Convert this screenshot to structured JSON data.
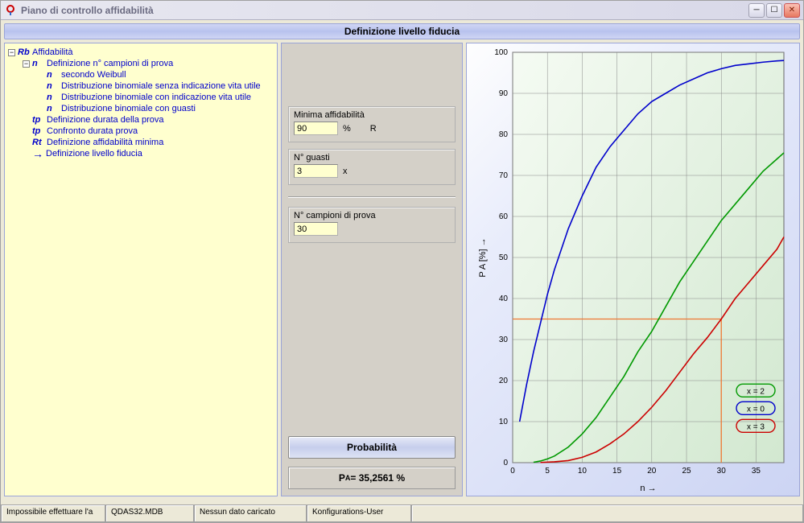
{
  "window": {
    "title": "Piano di controllo affidabilità"
  },
  "header": {
    "title": "Definizione livello fiducia"
  },
  "tree": {
    "root": {
      "icon": "Rb",
      "label": "Affidabilità",
      "children": [
        {
          "icon": "n",
          "label": "Definizione n° campioni di prova",
          "children": [
            {
              "icon": "n",
              "label": "secondo Weibull"
            },
            {
              "icon": "n",
              "label": "Distribuzione binomiale senza indicazione vita utile"
            },
            {
              "icon": "n",
              "label": "Distribuzione binomiale con indicazione vita utile"
            },
            {
              "icon": "n",
              "label": "Distribuzione binomiale con guasti"
            }
          ]
        },
        {
          "icon": "tp",
          "label": "Definizione durata della prova"
        },
        {
          "icon": "tp",
          "label": "Confronto durata prova"
        },
        {
          "icon": "Rt",
          "label": "Definizione affidabilità minima"
        },
        {
          "icon": "→",
          "label": "Definizione livello fiducia"
        }
      ]
    }
  },
  "form": {
    "min_reliability": {
      "label": "Minima affidabilità",
      "value": "90",
      "unit": "%",
      "suffix": "R"
    },
    "failures": {
      "label": "N° guasti",
      "value": "3",
      "unit": "x"
    },
    "samples": {
      "label": "N° campioni di prova",
      "value": "30"
    },
    "probability_button": "Probabilità",
    "result_prefix": "P",
    "result_sub": "A",
    "result_eq": "  = 35,2561 %"
  },
  "chart_data": {
    "type": "line",
    "xlabel": "n →",
    "ylabel": "P_A [%] →",
    "xlim": [
      0,
      39
    ],
    "ylim": [
      0,
      100
    ],
    "xticks": [
      0,
      5,
      10,
      15,
      20,
      25,
      30,
      35
    ],
    "yticks": [
      0,
      10,
      20,
      30,
      40,
      50,
      60,
      70,
      80,
      90,
      100
    ],
    "guide": {
      "x": 30,
      "y": 35
    },
    "legend": [
      {
        "name": "x = 2",
        "color": "#009900"
      },
      {
        "name": "x = 0",
        "color": "#0000cc"
      },
      {
        "name": "x = 3",
        "color": "#cc0000"
      }
    ],
    "series": [
      {
        "name": "x = 0",
        "color": "#0000cc",
        "x": [
          1,
          2,
          3,
          4,
          5,
          6,
          8,
          10,
          12,
          14,
          16,
          18,
          20,
          22,
          24,
          26,
          28,
          30,
          32,
          34,
          36,
          38,
          39
        ],
        "y": [
          10,
          19,
          27,
          34,
          41,
          47,
          57,
          65,
          72,
          77,
          81,
          85,
          88,
          90,
          92,
          93.5,
          95,
          96,
          96.8,
          97.2,
          97.6,
          97.9,
          98.0
        ]
      },
      {
        "name": "x = 2",
        "color": "#009900",
        "x": [
          3,
          4,
          5,
          6,
          8,
          10,
          12,
          14,
          16,
          18,
          20,
          22,
          24,
          26,
          28,
          30,
          32,
          34,
          36,
          38,
          39
        ],
        "y": [
          0.1,
          0.4,
          0.9,
          1.6,
          3.8,
          7,
          11,
          16,
          21,
          27,
          32,
          38,
          44,
          49,
          54,
          59,
          63,
          67,
          71,
          74,
          75.5
        ]
      },
      {
        "name": "x = 3",
        "color": "#cc0000",
        "x": [
          4,
          6,
          8,
          10,
          12,
          14,
          16,
          18,
          20,
          22,
          24,
          26,
          28,
          30,
          32,
          34,
          36,
          38,
          39
        ],
        "y": [
          0.05,
          0.2,
          0.5,
          1.3,
          2.6,
          4.6,
          7,
          10,
          13.5,
          17.5,
          22,
          26.5,
          30.5,
          35,
          40,
          44,
          48,
          52,
          55
        ]
      }
    ]
  },
  "status": {
    "cells": [
      "Impossibile effettuare l'a",
      "QDAS32.MDB",
      "Nessun dato caricato",
      "Konfigurations-User"
    ]
  }
}
